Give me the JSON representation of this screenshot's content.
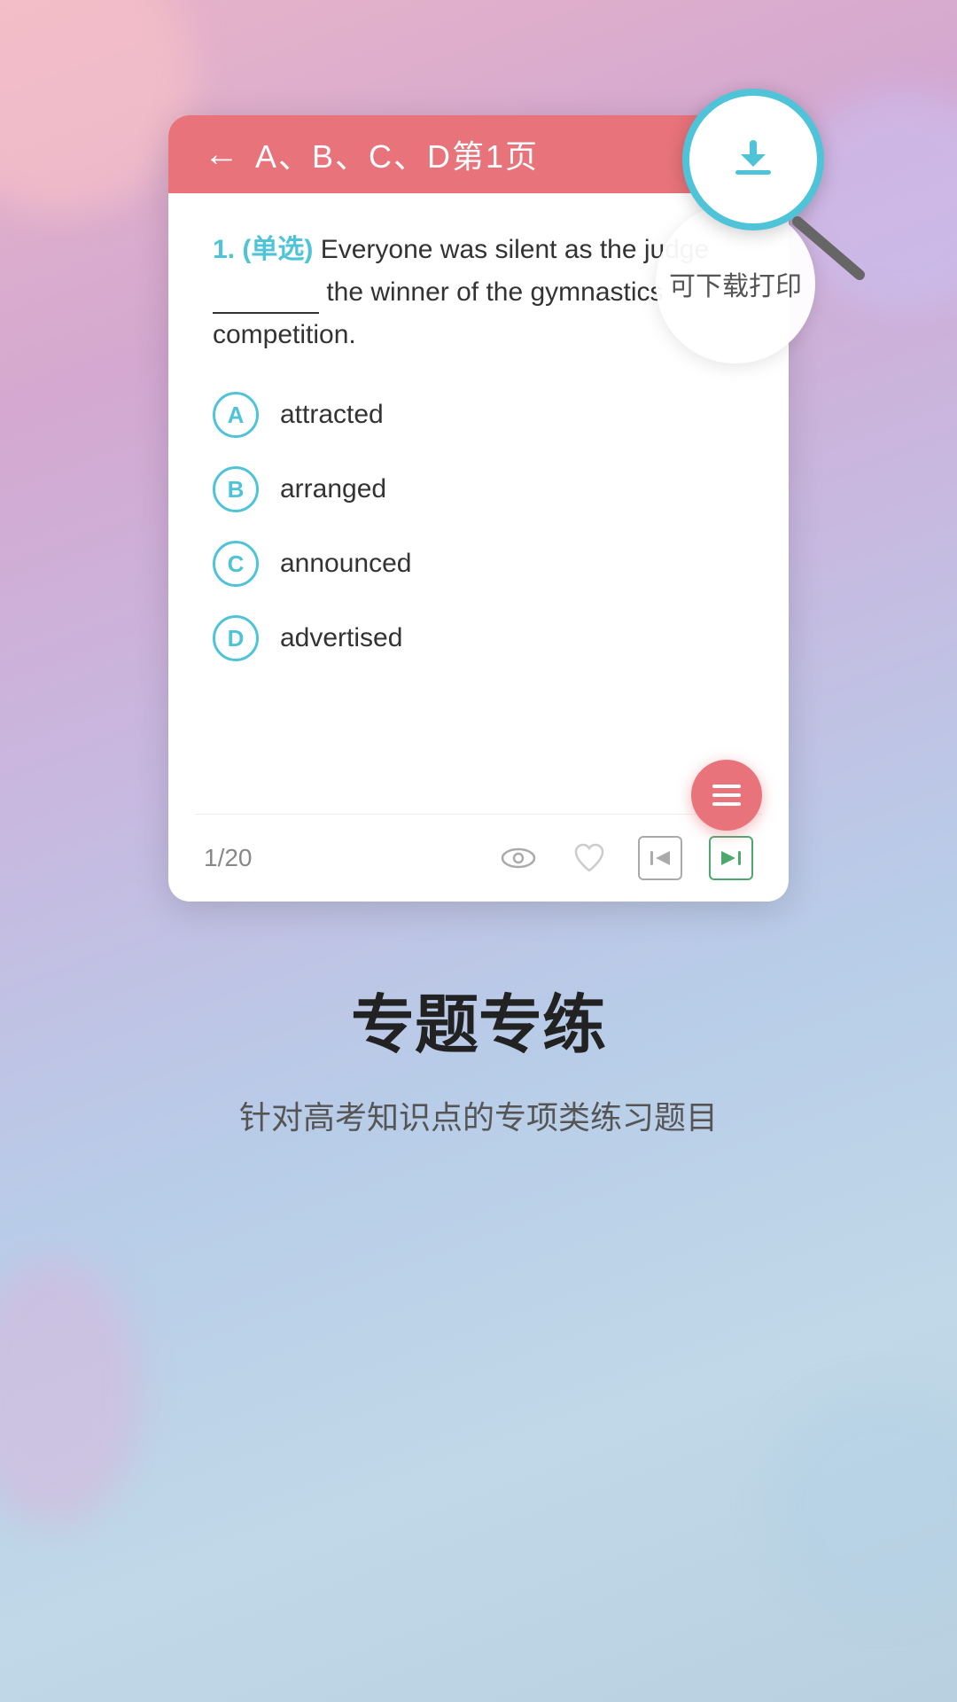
{
  "header": {
    "back_label": "←",
    "title": "A、B、C、D第1页",
    "calendar_icon": "📅"
  },
  "download_tooltip": "可下载打印",
  "question": {
    "number": "1.",
    "type": "(单选)",
    "text_before_blank": "Everyone was silent as the judge",
    "blank": "_________",
    "text_after_blank": "the winner of the gymnastics competition."
  },
  "options": [
    {
      "label": "A",
      "text": "attracted"
    },
    {
      "label": "B",
      "text": "arranged"
    },
    {
      "label": "C",
      "text": "announced"
    },
    {
      "label": "D",
      "text": "advertised"
    }
  ],
  "footer": {
    "page_indicator": "1/20"
  },
  "bottom_section": {
    "title": "专题专练",
    "subtitle": "针对高考知识点的专项类练习题目"
  }
}
